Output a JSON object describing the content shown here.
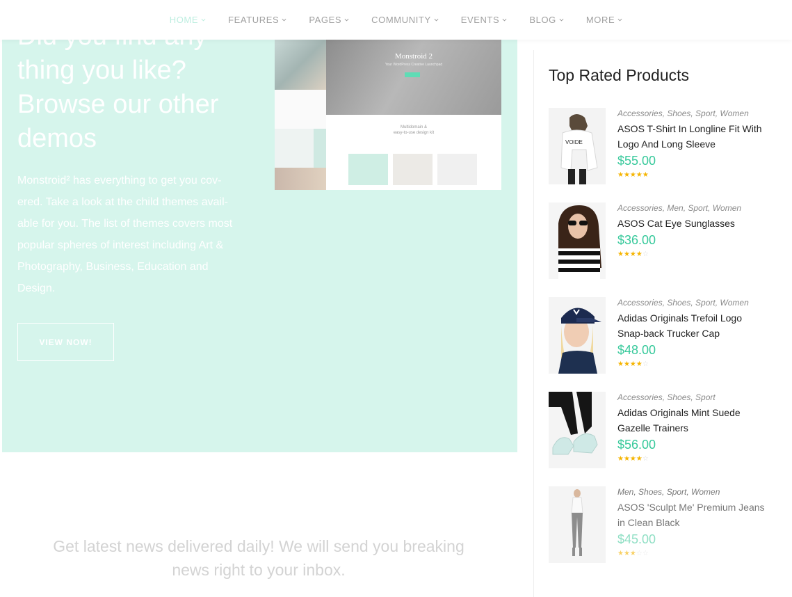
{
  "nav": {
    "items": [
      {
        "label": "HOME",
        "active": true
      },
      {
        "label": "FEATURES",
        "active": false
      },
      {
        "label": "PAGES",
        "active": false
      },
      {
        "label": "COMMUNITY",
        "active": false
      },
      {
        "label": "EVENTS",
        "active": false
      },
      {
        "label": "BLOG",
        "active": false
      },
      {
        "label": "MORE",
        "active": false
      }
    ]
  },
  "hero": {
    "heading_lines": [
      "Did you find any",
      "thing you like?",
      "Browse our other",
      "demos"
    ],
    "body": "Monstroid² has everything to get you cov-ered. Take a look at the child themes avail-able for you. The list of themes covers most popular spheres of interest including Art & Photography, Business, Education and Design.",
    "button_label": "VIEW NOW!",
    "mockup": {
      "title": "Monstroid 2",
      "subtitle": "Your WordPress Creative Launchpad",
      "caption_line1": "Multidomain &",
      "caption_line2": "easy-to-use design kit"
    },
    "bg_color": "#d6f5ec"
  },
  "newsletter": {
    "text": "Get latest news delivered daily! We will send you breaking news right to your inbox."
  },
  "sidebar": {
    "title": "Top Rated Products",
    "products": [
      {
        "categories": "Accessories, Shoes, Sport, Women",
        "name": "ASOS T-Shirt In Longline Fit With Logo And Long Sleeve",
        "price": "$55.00",
        "rating": 5,
        "image": "white-longsleeve-tshirt"
      },
      {
        "categories": "Accessories, Men, Sport, Women",
        "name": "ASOS Cat Eye Sunglasses",
        "price": "$36.00",
        "rating": 4,
        "image": "woman-sunglasses-striped-top"
      },
      {
        "categories": "Accessories, Shoes, Sport, Women",
        "name": "Adidas Originals Trefoil Logo Snap-back Trucker Cap",
        "price": "$48.00",
        "rating": 4,
        "image": "woman-navy-cap"
      },
      {
        "categories": "Accessories, Shoes, Sport",
        "name": "Adidas Originals Mint Suede Gazelle Trainers",
        "price": "$56.00",
        "rating": 4,
        "image": "mint-sneakers"
      },
      {
        "categories": "Men, Shoes, Sport, Women",
        "name": "ASOS 'Sculpt Me' Premium Jeans in Clean Black",
        "price": "$45.00",
        "rating": 3,
        "image": "woman-grey-jeans"
      }
    ]
  },
  "colors": {
    "accent": "#37c99b",
    "star": "#f5b400",
    "nav_active": "#bdeee0"
  }
}
